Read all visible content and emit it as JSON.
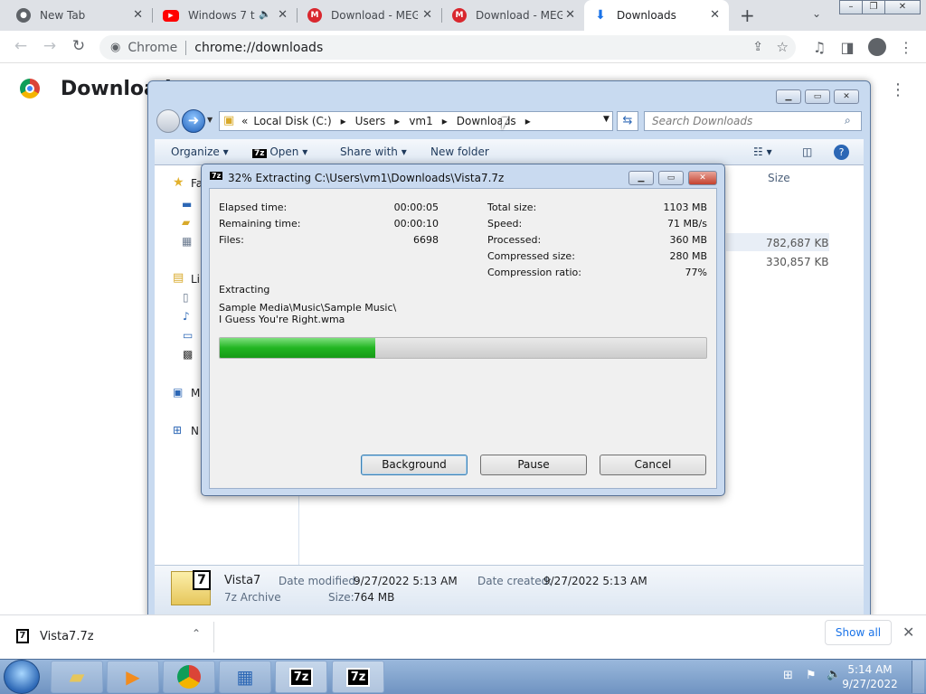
{
  "browser": {
    "tabs": [
      {
        "title": "New Tab",
        "icon": "chrome-icon"
      },
      {
        "title": "Windows 7 t",
        "icon": "youtube-icon"
      },
      {
        "title": "Download - MEG",
        "icon": "mega-icon"
      },
      {
        "title": "Download - MEG",
        "icon": "mega-icon"
      },
      {
        "title": "Downloads",
        "icon": "download-icon"
      }
    ],
    "omnibox_label": "Chrome",
    "url": "chrome://downloads",
    "page_title": "Downloads"
  },
  "explorer": {
    "breadcrumb": [
      "Local Disk (C:)",
      "Users",
      "vm1",
      "Downloads"
    ],
    "search_placeholder": "Search Downloads",
    "commands": {
      "organize": "Organize",
      "open": "Open",
      "share": "Share with",
      "new_folder": "New folder"
    },
    "nav": {
      "favorites": "Fa",
      "libraries": "Li",
      "computer": "M",
      "network": "N"
    },
    "columns": {
      "size": "Size"
    },
    "rows": [
      {
        "size": "782,687 KB"
      },
      {
        "size": "330,857 KB"
      }
    ],
    "details": {
      "name": "Vista7",
      "type": "7z Archive",
      "modified_label": "Date modified:",
      "modified": "9/27/2022 5:13 AM",
      "created_label": "Date created:",
      "created": "9/27/2022 5:13 AM",
      "size_label": "Size:",
      "size": "764 MB"
    }
  },
  "zip": {
    "title": "32% Extracting C:\\Users\\vm1\\Downloads\\Vista7.7z",
    "progress": 0.32,
    "left_stats": [
      {
        "label": "Elapsed time:",
        "value": "00:00:05"
      },
      {
        "label": "Remaining time:",
        "value": "00:00:10"
      },
      {
        "label": "Files:",
        "value": "6698"
      }
    ],
    "right_stats": [
      {
        "label": "Total size:",
        "value": "1103 MB"
      },
      {
        "label": "Speed:",
        "value": "71 MB/s"
      },
      {
        "label": "Processed:",
        "value": "360 MB"
      },
      {
        "label": "Compressed size:",
        "value": "280 MB"
      },
      {
        "label": "Compression ratio:",
        "value": "77%"
      }
    ],
    "status": "Extracting",
    "path_line1": "Sample Media\\Music\\Sample Music\\",
    "path_line2": "I Guess You're Right.wma",
    "buttons": {
      "background": "Background",
      "pause": "Pause",
      "cancel": "Cancel"
    }
  },
  "shelf": {
    "file": "Vista7.7z",
    "show_all": "Show all"
  },
  "taskbar": {
    "time": "5:14 AM",
    "date": "9/27/2022"
  }
}
